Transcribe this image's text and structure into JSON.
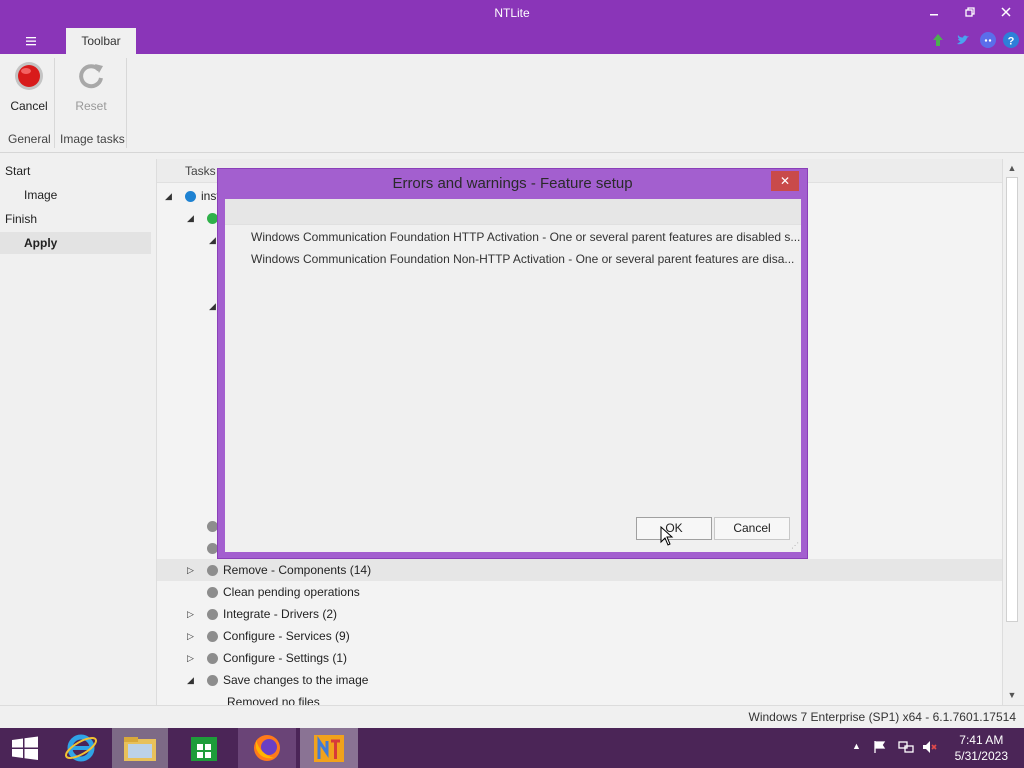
{
  "window": {
    "title": "NTLite"
  },
  "ribbon": {
    "tab": "Toolbar",
    "cancel_label": "Cancel",
    "reset_label": "Reset",
    "group_general": "General",
    "group_image_tasks": "Image tasks"
  },
  "nav": {
    "start": "Start",
    "image": "Image",
    "finish": "Finish",
    "apply": "Apply"
  },
  "tree": {
    "column_header": "Tasks",
    "root_label": "inst",
    "items": [
      {
        "label": "Remove - Components (14)"
      },
      {
        "label": "Clean pending operations"
      },
      {
        "label": "Integrate - Drivers (2)"
      },
      {
        "label": "Configure - Services (9)"
      },
      {
        "label": "Configure - Settings (1)"
      },
      {
        "label": "Save changes to the image"
      },
      {
        "label": "Removed no files"
      }
    ]
  },
  "status": {
    "text": "Windows 7 Enterprise (SP1) x64 - 6.1.7601.17514"
  },
  "dialog": {
    "title": "Errors and warnings - Feature setup",
    "close_glyph": "✕",
    "messages": [
      "Windows Communication Foundation HTTP Activation - One or several parent features are disabled s...",
      "Windows Communication Foundation Non-HTTP Activation - One or several parent features are disa..."
    ],
    "ok_label": "OK",
    "cancel_label": "Cancel"
  },
  "taskbar": {
    "time": "7:41 AM",
    "date": "5/31/2023"
  },
  "colors": {
    "accent": "#8a35b8",
    "dialog_frame": "#a35fcf",
    "taskbar": "#4b2557"
  }
}
